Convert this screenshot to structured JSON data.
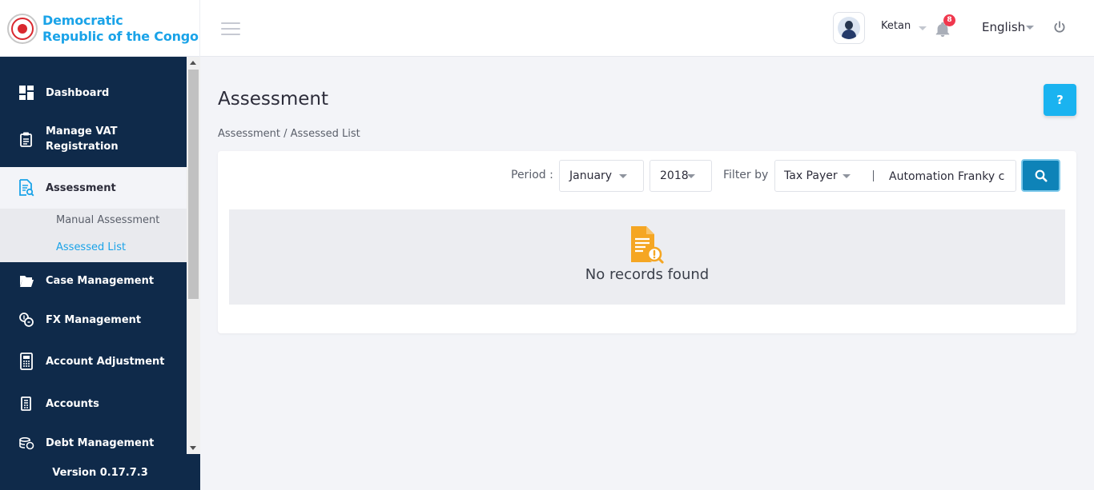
{
  "header": {
    "brand_line1": "Democratic",
    "brand_line2": "Republic of the Congo",
    "user_name": "Ketan",
    "notification_count": "8",
    "language": "English"
  },
  "sidebar": {
    "items": [
      {
        "label": "Dashboard",
        "icon": "dashboard-icon"
      },
      {
        "label": "Manage VAT Registration",
        "icon": "vat-registration-icon"
      },
      {
        "label": "Assessment",
        "icon": "assessment-icon"
      },
      {
        "label": "Case Management",
        "icon": "folder-icon"
      },
      {
        "label": "FX Management",
        "icon": "fx-icon"
      },
      {
        "label": "Account Adjustment",
        "icon": "calculator-icon"
      },
      {
        "label": "Accounts",
        "icon": "accounts-icon"
      },
      {
        "label": "Debt Management",
        "icon": "debt-icon"
      }
    ],
    "sub_items": [
      {
        "label": "Manual Assessment"
      },
      {
        "label": "Assessed List"
      }
    ],
    "version": "Version 0.17.7.3"
  },
  "main": {
    "title": "Assessment",
    "help_label": "?",
    "breadcrumb": "Assessment / Assessed List",
    "period_label": "Period :",
    "month": "January",
    "year": "2018",
    "filter_label": "Filter by",
    "filter_type": "Tax Payer",
    "filter_value": "Automation Franky c",
    "empty_text": "No records found"
  },
  "colors": {
    "sidebar_bg": "#0f2a4a",
    "accent": "#1aa3e8",
    "search_button": "#0e83b8",
    "empty_icon": "#f5a623",
    "badge": "#f0384e"
  }
}
